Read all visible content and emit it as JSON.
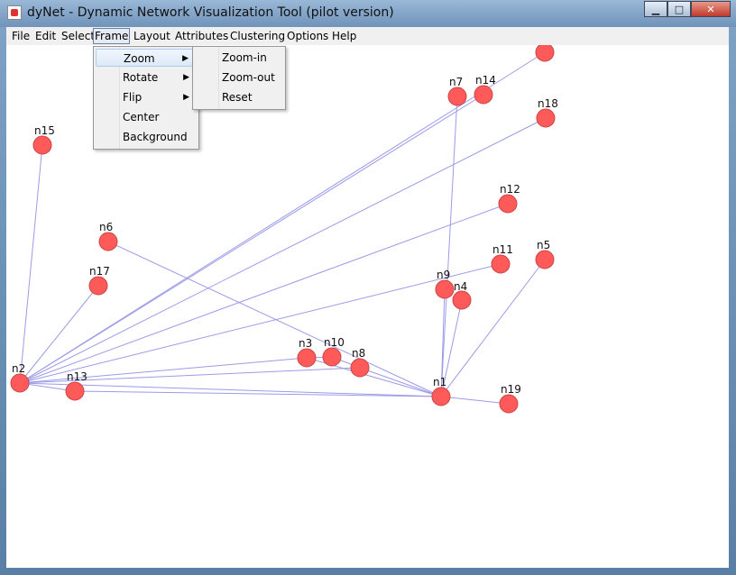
{
  "window": {
    "title": "dyNet - Dynamic Network Visualization Tool (pilot version)"
  },
  "window_buttons": {
    "minimize": "▁",
    "maximize": "□",
    "close": "✕"
  },
  "menubar": [
    {
      "label": "File"
    },
    {
      "label": "Edit"
    },
    {
      "label": "Select"
    },
    {
      "label": "Frame",
      "open": true
    },
    {
      "label": "Layout"
    },
    {
      "label": "Attributes"
    },
    {
      "label": "Clustering"
    },
    {
      "label": "Options"
    },
    {
      "label": "Help"
    }
  ],
  "frame_menu": [
    {
      "label": "Zoom",
      "submenu": true,
      "highlighted": true
    },
    {
      "label": "Rotate",
      "submenu": true
    },
    {
      "label": "Flip",
      "submenu": true
    },
    {
      "label": "Center"
    },
    {
      "label": "Background"
    }
  ],
  "zoom_submenu": [
    {
      "label": "Zoom-in"
    },
    {
      "label": "Zoom-out"
    },
    {
      "label": "Reset"
    }
  ],
  "graph": {
    "node_color": "#ff5a5a",
    "edge_color": "#9b9be8",
    "nodes": [
      {
        "id": "n15",
        "label": "n15"
      },
      {
        "id": "n6",
        "label": "n6"
      },
      {
        "id": "n17",
        "label": "n17"
      },
      {
        "id": "n2",
        "label": "n2"
      },
      {
        "id": "n13",
        "label": "n13"
      },
      {
        "id": "n3",
        "label": "n3"
      },
      {
        "id": "n10",
        "label": "n10"
      },
      {
        "id": "n8",
        "label": "n8"
      },
      {
        "id": "n1",
        "label": "n1"
      },
      {
        "id": "n19",
        "label": "n19"
      },
      {
        "id": "n9",
        "label": "n9"
      },
      {
        "id": "n4",
        "label": "n4"
      },
      {
        "id": "n11",
        "label": "n11"
      },
      {
        "id": "n5",
        "label": "n5"
      },
      {
        "id": "n12",
        "label": "n12"
      },
      {
        "id": "n7",
        "label": "n7"
      },
      {
        "id": "n14",
        "label": "n14"
      },
      {
        "id": "n18",
        "label": "n18"
      },
      {
        "id": "n_top",
        "label": ""
      }
    ],
    "edges": [
      [
        "n2",
        "n15"
      ],
      [
        "n2",
        "n17"
      ],
      [
        "n2",
        "n13"
      ],
      [
        "n2",
        "n3"
      ],
      [
        "n2",
        "n1"
      ],
      [
        "n2",
        "n12"
      ],
      [
        "n2",
        "n18"
      ],
      [
        "n2",
        "n14"
      ],
      [
        "n2",
        "n_top"
      ],
      [
        "n2",
        "n11"
      ],
      [
        "n2",
        "n8"
      ],
      [
        "n6",
        "n1"
      ],
      [
        "n3",
        "n10"
      ],
      [
        "n10",
        "n8"
      ],
      [
        "n3",
        "n1"
      ],
      [
        "n8",
        "n1"
      ],
      [
        "n1",
        "n19"
      ],
      [
        "n1",
        "n9"
      ],
      [
        "n1",
        "n4"
      ],
      [
        "n1",
        "n5"
      ],
      [
        "n1",
        "n7"
      ],
      [
        "n13",
        "n1"
      ]
    ]
  }
}
